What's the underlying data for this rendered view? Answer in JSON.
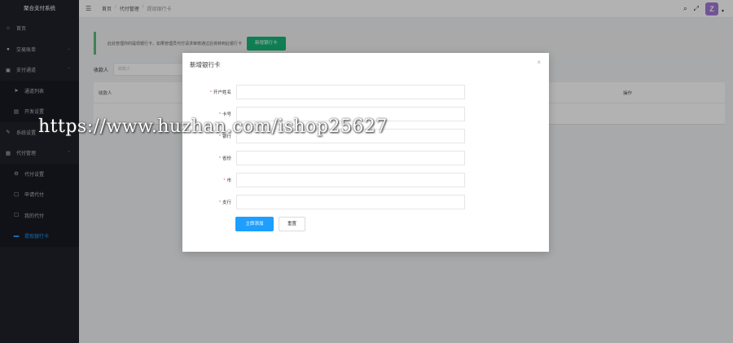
{
  "app": {
    "title": "聚合支付系统"
  },
  "sidebar": {
    "items": [
      {
        "label": "首页",
        "icon": "home-icon",
        "glyph": "⌂"
      },
      {
        "label": "交易账单",
        "icon": "user-icon",
        "glyph": "●",
        "chevron": "⌄"
      },
      {
        "label": "支付通道",
        "icon": "card-icon",
        "glyph": "▣",
        "chevron": "⌃"
      },
      {
        "label": "通道列表",
        "icon": "send-icon",
        "glyph": "➤"
      },
      {
        "label": "开发设置",
        "icon": "doc-icon",
        "glyph": "▤"
      },
      {
        "label": "系统设置",
        "icon": "edit-icon",
        "glyph": "✎",
        "chevron": "⌄"
      },
      {
        "label": "代付管理",
        "icon": "grid-icon",
        "glyph": "▦",
        "chevron": "⌃"
      },
      {
        "label": "代付设置",
        "icon": "gear-icon",
        "glyph": "⚙"
      },
      {
        "label": "申请代付",
        "icon": "form-icon",
        "glyph": "☐"
      },
      {
        "label": "我的代付",
        "icon": "form-icon",
        "glyph": "☐"
      },
      {
        "label": "提现银行卡",
        "icon": "bankcard-icon",
        "glyph": "▬"
      }
    ]
  },
  "header": {
    "breadcrumbs": [
      "首页",
      "代付管理",
      "提现银行卡"
    ],
    "separator": "/",
    "avatar_letter": "Z",
    "fold_glyph": "☰",
    "search_glyph": "⌕",
    "fullscreen_glyph": "⤢",
    "caret_glyph": "▼"
  },
  "main": {
    "tip_text": "此处管理你的提现银行卡，如果管理员代付请求审核通过后将转到此银行卡",
    "add_button": "新增银行卡",
    "filter_label": "收款人",
    "filter_placeholder": "收款人",
    "table_headers": [
      "收款人",
      "操作"
    ]
  },
  "modal": {
    "title": "新增银行卡",
    "close_glyph": "×",
    "fields": [
      {
        "label": "开户姓名",
        "required_mark": "*"
      },
      {
        "label": "卡号",
        "required_mark": "*"
      },
      {
        "label": "银行",
        "required_mark": "*"
      },
      {
        "label": "省份",
        "required_mark": "*"
      },
      {
        "label": "市",
        "required_mark": "*"
      },
      {
        "label": "支行",
        "required_mark": "*"
      }
    ],
    "submit_label": "立即添加",
    "reset_label": "重置"
  },
  "watermark": "https://www.huzhan.com/ishop25627",
  "colors": {
    "sidebar_bg": "#20222a",
    "primary": "#1e9fff",
    "success": "#16b777",
    "avatar": "#a17ad6",
    "required": "#ff5722"
  }
}
